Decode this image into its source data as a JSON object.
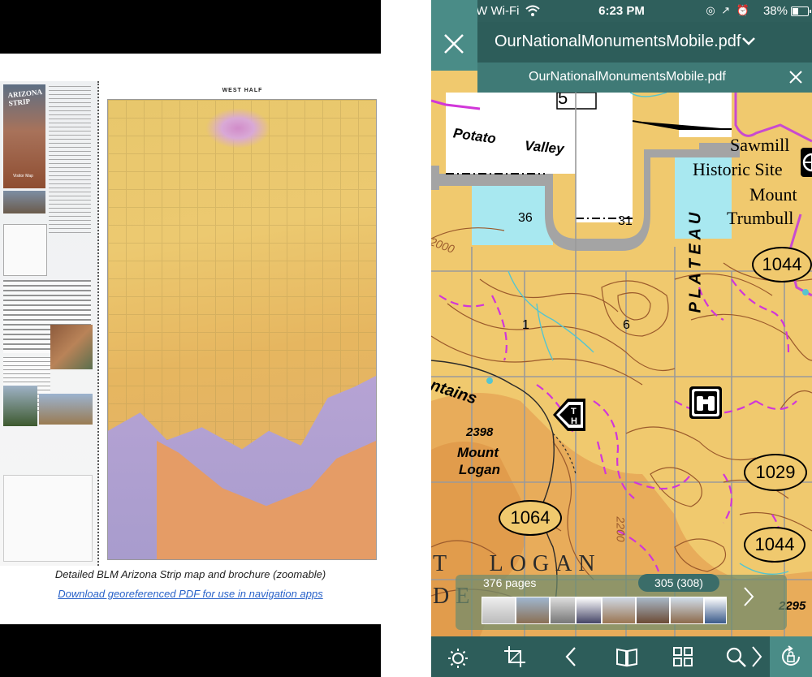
{
  "left": {
    "brochure": {
      "cover_title": "ARIZONA STRIP",
      "cover_subtitle": "Visitor Map"
    },
    "map_sheet_title": "WEST HALF",
    "caption": "Detailed BLM Arizona Strip map and brochure (zoomable)",
    "download_link": "Download georeferenced PDF for use in navigation apps"
  },
  "status_bar": {
    "carrier": "VZW Wi-Fi",
    "time": "6:23 PM",
    "battery": "38%"
  },
  "toolbar": {
    "document_title": "OurNationalMonumentsMobile.pdf"
  },
  "tab": {
    "label": "OurNationalMonumentsMobile.pdf"
  },
  "map": {
    "labels": {
      "potato": "Potato",
      "valley": "Valley",
      "sawmill": "Sawmill",
      "historic_site": "Historic Site",
      "mount": "Mount",
      "trumbull": "Trumbull",
      "plateau": "P L A T E A U",
      "ntains": "ntains",
      "elev_2398": "2398",
      "mount_logan_1": "Mount",
      "mount_logan_2": "Logan",
      "logan_large": "T   LOGAN",
      "de": "DE",
      "elev_2295": "2295",
      "contour_2000": "2000",
      "contour_2200": "2200"
    },
    "section_numbers": [
      "5",
      "36",
      "31",
      "1",
      "6"
    ],
    "road_shields": [
      "1044",
      "1029",
      "1064",
      "1044"
    ],
    "trailhead_label": "TH",
    "colors": {
      "land": "#f0c96e",
      "private": "#ffffff",
      "state": "#a8e8f0",
      "dark_land": "#e8ac5a",
      "boundary": "#c94ad0",
      "road": "#a8a8a8"
    }
  },
  "thumbnails": {
    "pages_label": "376 pages",
    "current_page": "305 (308)"
  },
  "bottom_toolbar": {
    "icons": [
      "brightness-icon",
      "crop-icon",
      "back-icon",
      "book-icon",
      "grid-icon",
      "search-icon",
      "rotate-lock-icon"
    ]
  }
}
